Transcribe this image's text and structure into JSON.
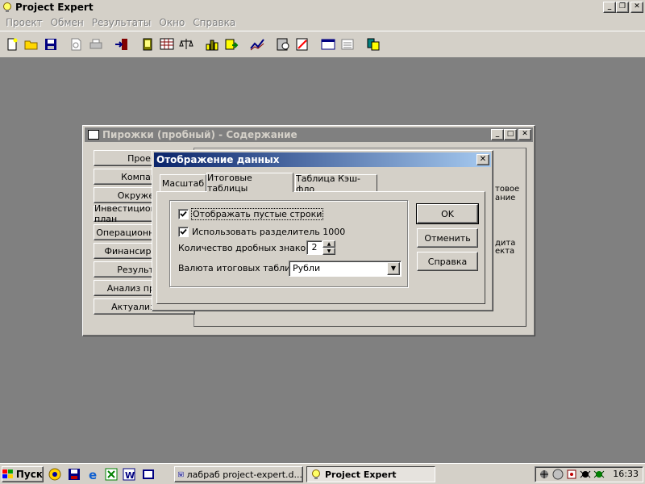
{
  "app": {
    "title": "Project Expert",
    "menu": [
      "Проект",
      "Обмен",
      "Результаты",
      "Окно",
      "Справка"
    ]
  },
  "toolbar": {
    "icons": [
      "new-document",
      "open-folder",
      "save-disk",
      "print-preview",
      "print",
      "exit-door",
      "reports",
      "cash-flow-table",
      "balance-scales",
      "bar-chart",
      "export",
      "line-chart",
      "analysis",
      "report-editor",
      "window-tiles",
      "window-list",
      "database"
    ]
  },
  "content_window": {
    "title": "Пирожки (пробный) - Содержание",
    "side_buttons": [
      "Проект",
      "Компания",
      "Окружение",
      "Инвестиционный план",
      "Операционный план",
      "Финансирование",
      "Результаты",
      "Анализ проекта",
      "Актуализация"
    ],
    "right_labels": [
      "товое",
      "ание",
      "дита",
      "екта"
    ]
  },
  "dialog": {
    "title": "Отображение данных",
    "tabs": [
      "Масштаб",
      "Итоговые таблицы",
      "Таблица Кэш-фло"
    ],
    "active_tab": "Итоговые таблицы",
    "show_empty_rows": {
      "label": "Отображать пустые строки",
      "checked": true
    },
    "use_separator": {
      "label": "Использовать разделитель 1000",
      "checked": true
    },
    "decimal_places": {
      "label": "Количество дробных знаков:",
      "value": "2"
    },
    "currency": {
      "label": "Валюта итоговых таблиц:",
      "value": "Рубли"
    },
    "buttons": {
      "ok": "OK",
      "cancel": "Отменить",
      "help": "Справка"
    }
  },
  "taskbar": {
    "start": "Пуск",
    "tasks": [
      "лабраб project-expert.d...",
      "Project Expert"
    ],
    "clock": "16:33"
  }
}
